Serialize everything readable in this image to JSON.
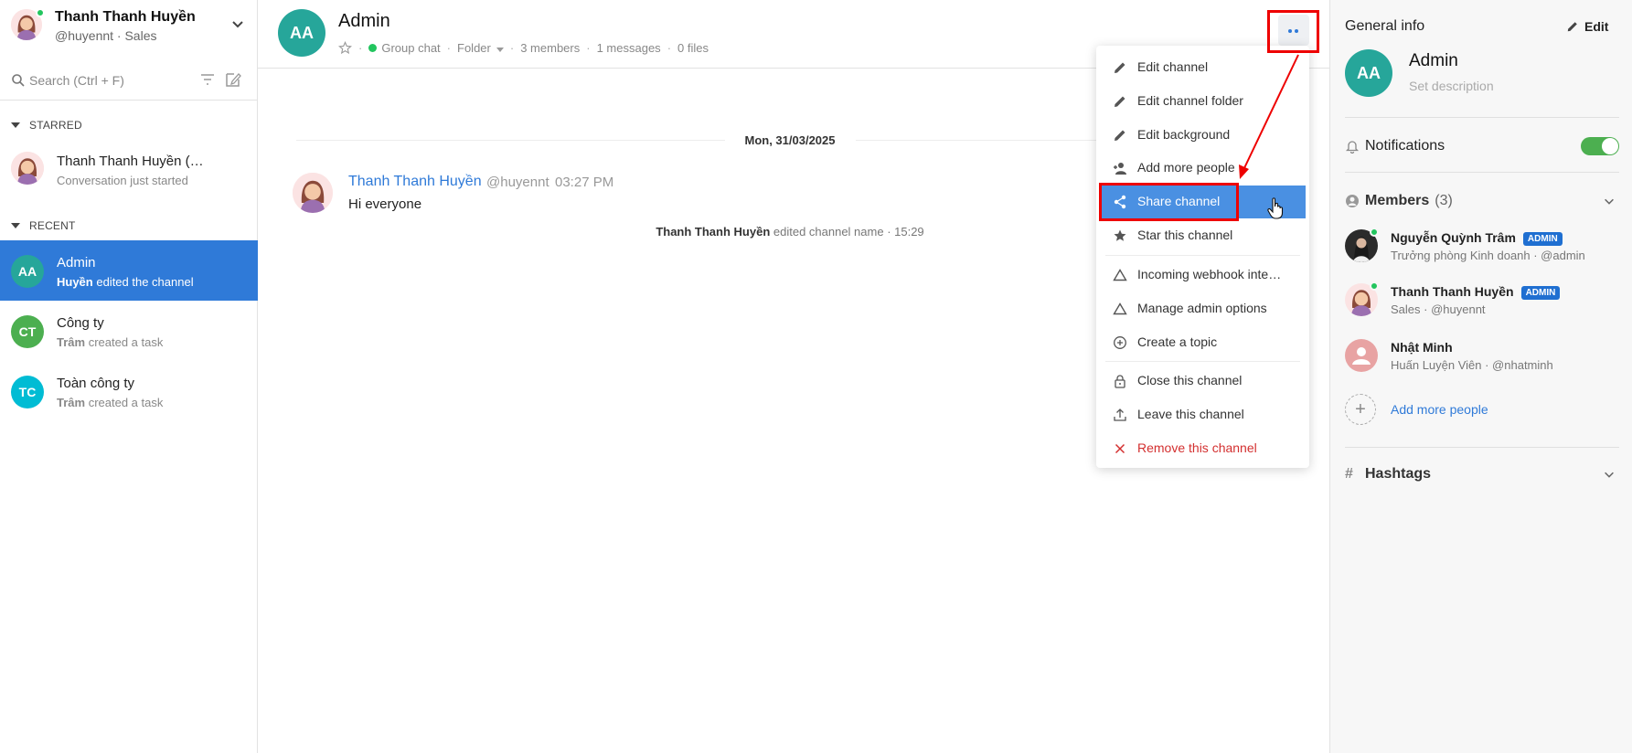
{
  "current_user": {
    "name": "Thanh Thanh Huyền",
    "subtitle": "@huyennt · Sales"
  },
  "search": {
    "placeholder": "Search (Ctrl + F)"
  },
  "sidebar": {
    "starred_label": "STARRED",
    "recent_label": "RECENT",
    "starred": [
      {
        "title": "Thanh Thanh Huyền (…",
        "subtitle": "Conversation just started"
      }
    ],
    "recent": [
      {
        "initials": "AA",
        "title": "Admin",
        "actor": "Huyền",
        "action": " edited the channel",
        "color": "#26a69a",
        "active": true
      },
      {
        "initials": "CT",
        "title": "Công ty",
        "actor": "Trâm",
        "action": " created a task",
        "color": "#4caf50",
        "active": false
      },
      {
        "initials": "TC",
        "title": "Toàn công ty",
        "actor": "Trâm",
        "action": " created a task",
        "color": "#00bcd4",
        "active": false
      }
    ]
  },
  "channel": {
    "initials": "AA",
    "name": "Admin",
    "type": "Group chat",
    "folder": "Folder",
    "members": "3 members",
    "messages": "1 messages",
    "files": "0 files"
  },
  "conversation": {
    "date": "Mon, 31/03/2025",
    "message": {
      "author": "Thanh Thanh Huyền",
      "handle": "@huyennt",
      "time": "03:27 PM",
      "text": "Hi everyone"
    },
    "system": {
      "actor": "Thanh Thanh Huyền",
      "text": " edited channel name · 15:29"
    }
  },
  "menu": {
    "items": [
      {
        "label": "Edit channel",
        "icon": "pencil-icon"
      },
      {
        "label": "Edit channel folder",
        "icon": "pencil-icon"
      },
      {
        "label": "Edit background",
        "icon": "pencil-icon"
      },
      {
        "label": "Add more people",
        "icon": "add-person-icon"
      },
      {
        "label": "Share channel",
        "icon": "share-icon",
        "highlighted": true
      },
      {
        "label": "Star this channel",
        "icon": "star-icon"
      },
      {
        "label": "Incoming webhook inte…",
        "icon": "triangle-icon"
      },
      {
        "label": "Manage admin options",
        "icon": "triangle-icon"
      },
      {
        "label": "Create a topic",
        "icon": "plus-circle-icon"
      },
      {
        "label": "Close this channel",
        "icon": "lock-icon"
      },
      {
        "label": "Leave this channel",
        "icon": "upload-icon"
      },
      {
        "label": "Remove this channel",
        "icon": "close-icon",
        "danger": true
      }
    ]
  },
  "info_panel": {
    "heading": "General info",
    "edit_label": "Edit",
    "group_initials": "AA",
    "group_name": "Admin",
    "description_placeholder": "Set description",
    "notifications_label": "Notifications",
    "notifications_on": true,
    "members_label": "Members",
    "members_count": "(3)",
    "members": [
      {
        "name": "Nguyễn Quỳnh Trâm",
        "badge": "ADMIN",
        "subtitle": "Trưởng phòng Kinh doanh · @admin",
        "online": true
      },
      {
        "name": "Thanh Thanh Huyền",
        "badge": "ADMIN",
        "subtitle": "Sales · @huyennt",
        "online": true
      },
      {
        "name": "Nhật Minh",
        "badge": "",
        "subtitle": "Huấn Luyện Viên · @nhatminh",
        "online": false
      }
    ],
    "add_people_label": "Add more people",
    "hashtags_label": "Hashtags"
  },
  "colors": {
    "accent": "#2f7ad8",
    "highlight": "#4a90e2",
    "online": "#22c55e",
    "danger": "#d32f2f",
    "annotation": "#e00000"
  }
}
